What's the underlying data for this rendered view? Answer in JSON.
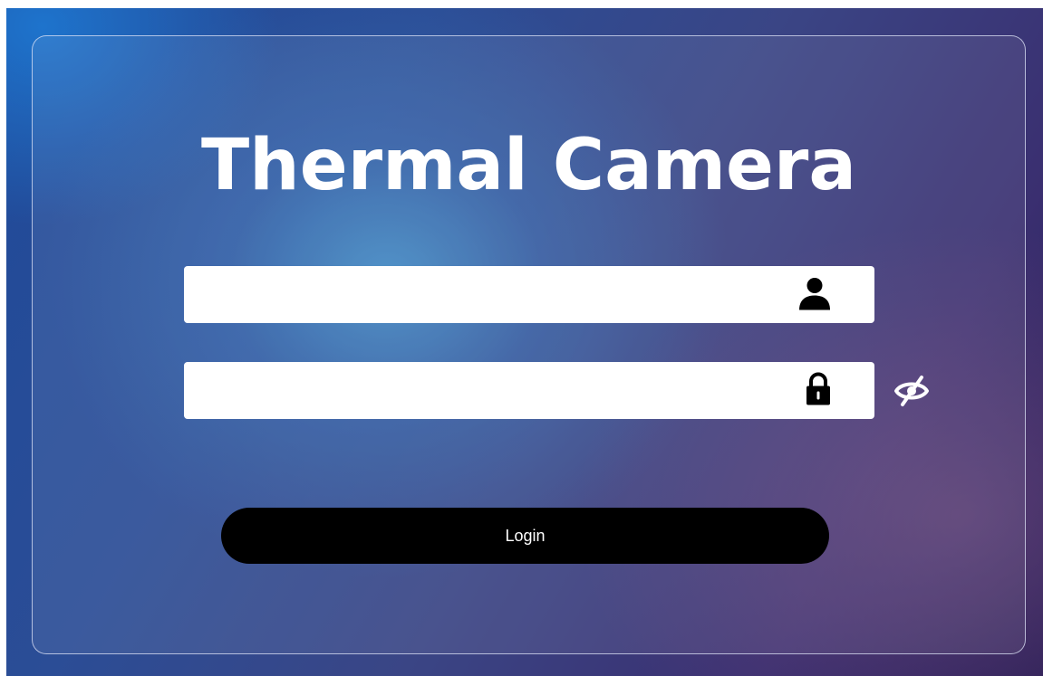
{
  "login": {
    "title": "Thermal Camera",
    "username": {
      "value": "",
      "placeholder": "",
      "icon": "user-icon"
    },
    "password": {
      "value": "",
      "placeholder": "",
      "icon": "lock-icon",
      "visibility_icon": "eye-slash-icon"
    },
    "submit_label": "Login"
  },
  "colors": {
    "button_bg": "#000000",
    "button_text": "#ffffff",
    "title_text": "#ffffff",
    "field_bg": "#ffffff"
  }
}
